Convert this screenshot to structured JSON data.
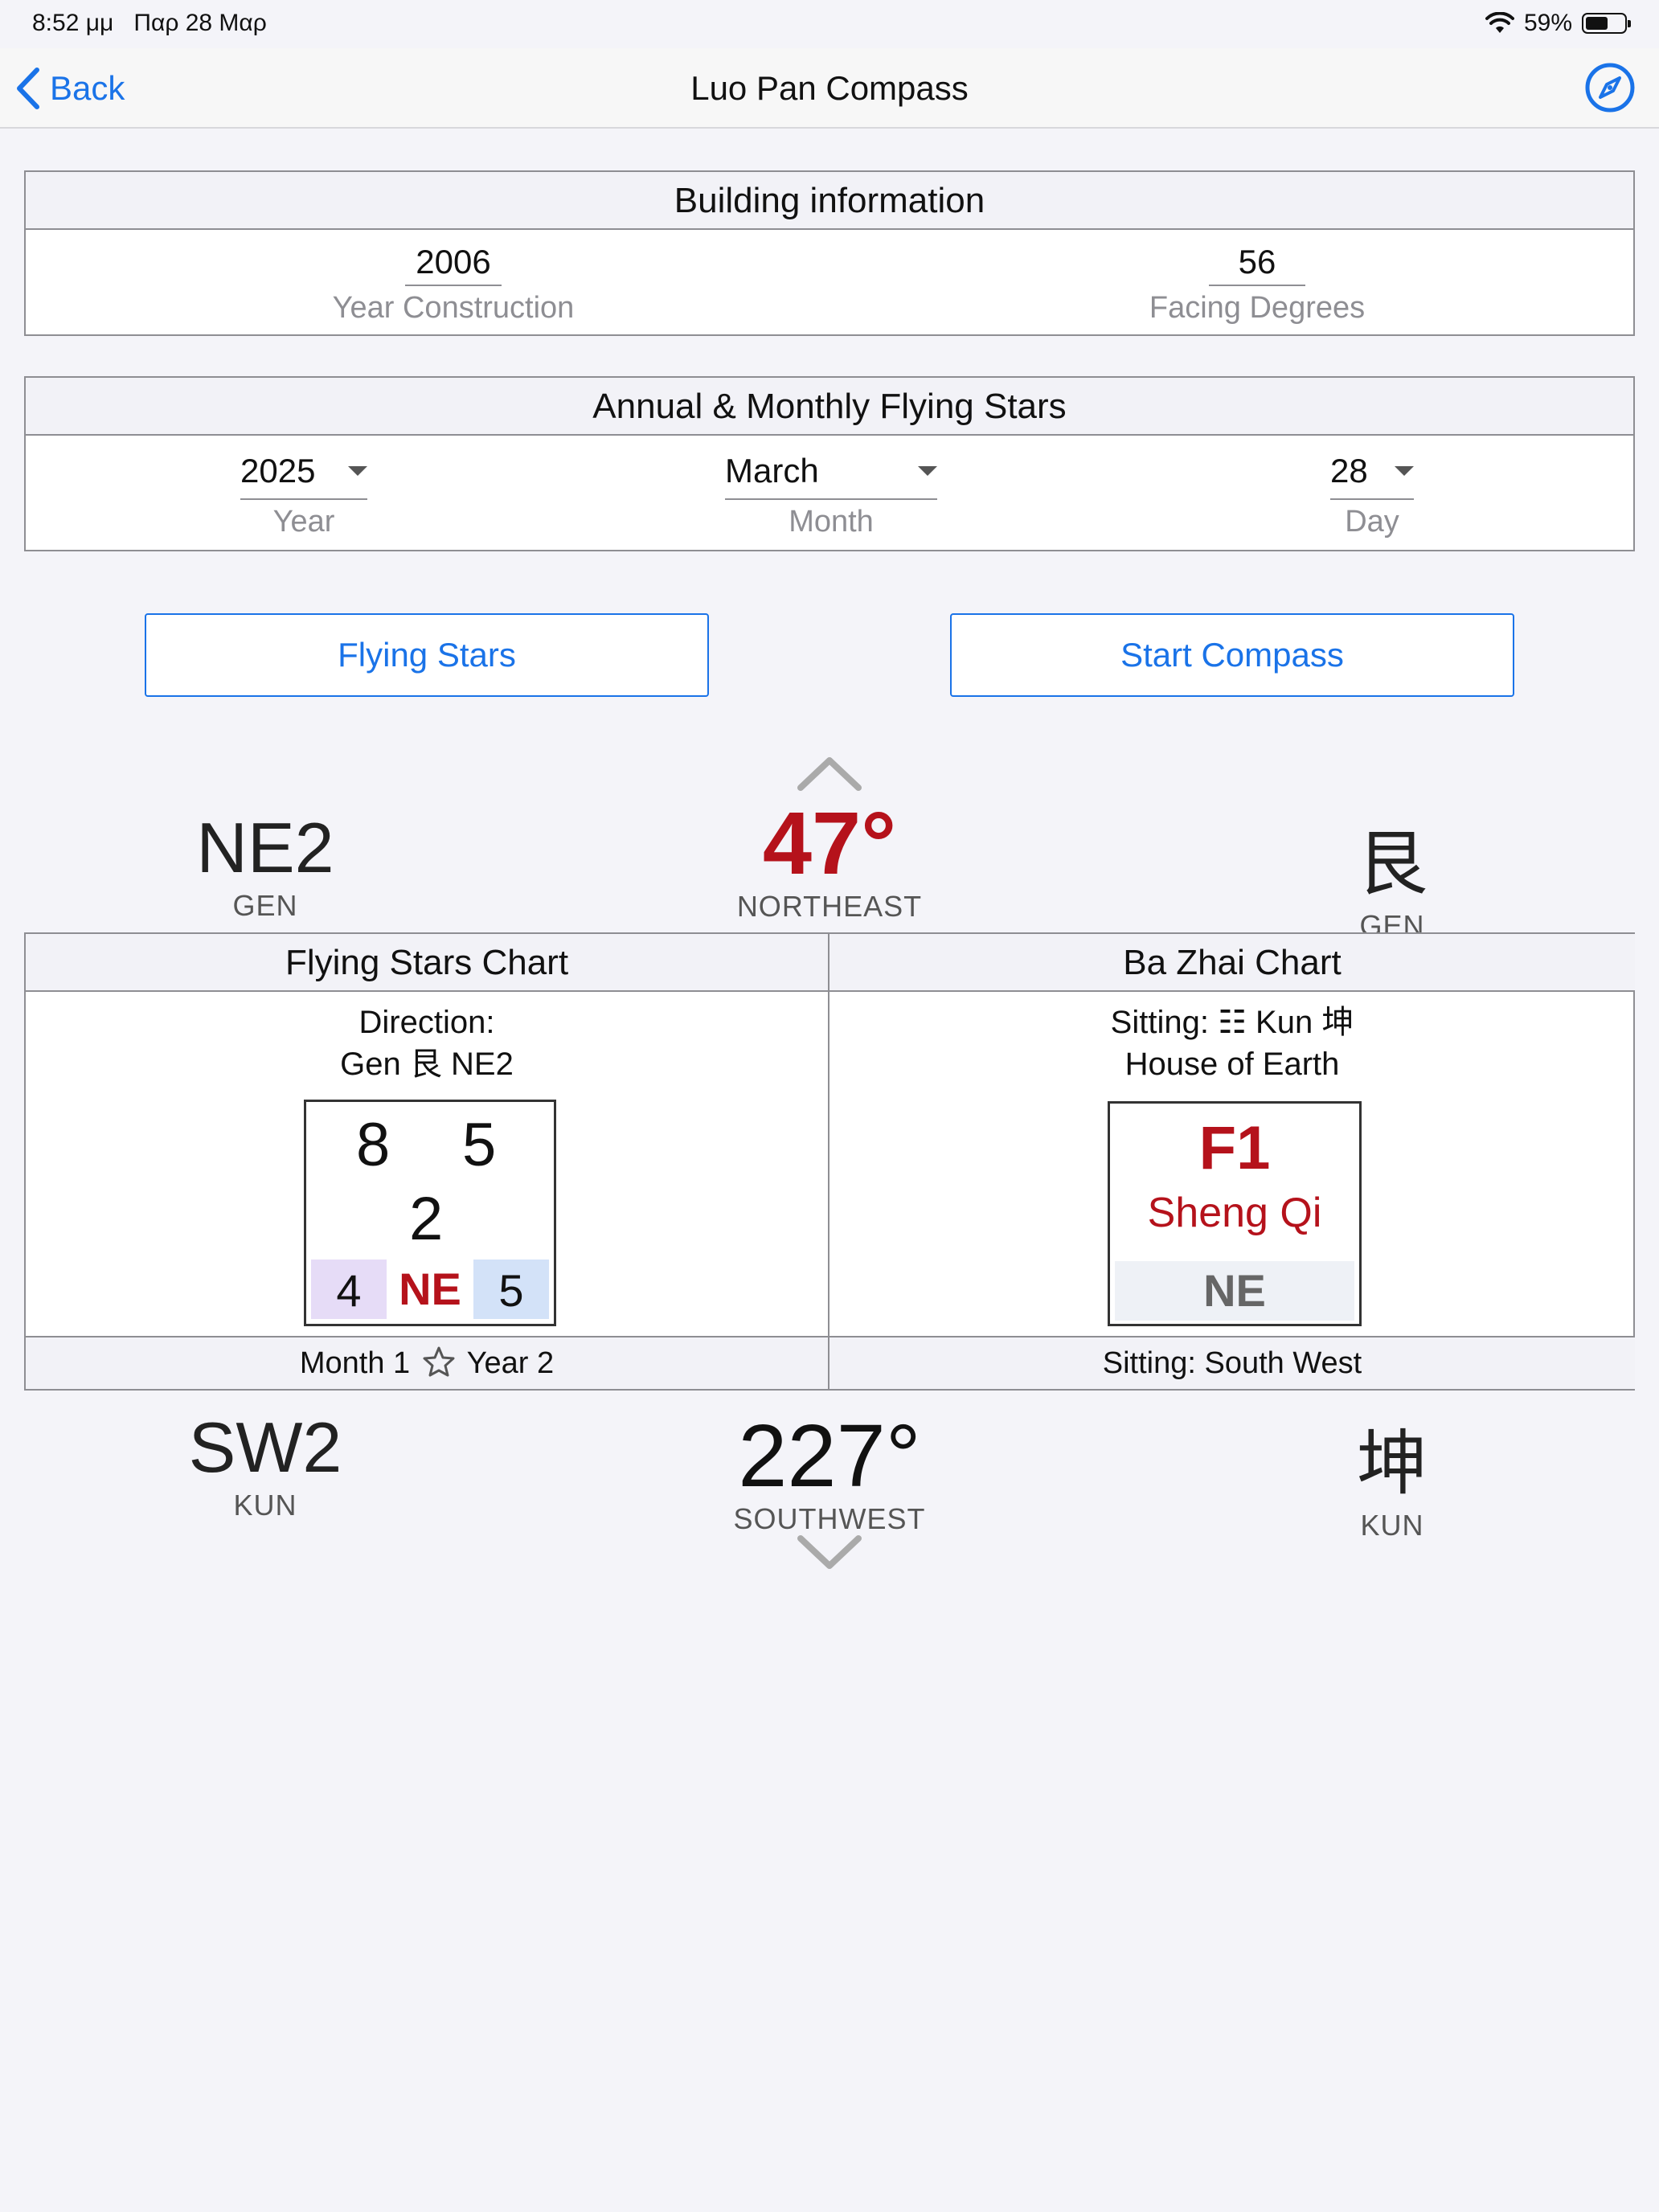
{
  "status_bar": {
    "time": "8:52 μμ",
    "date": "Παρ 28 Μαρ",
    "battery": "59%",
    "battery_level": 0.59
  },
  "nav": {
    "back_label": "Back",
    "title": "Luo Pan Compass"
  },
  "building": {
    "header": "Building information",
    "year_value": "2006",
    "year_label": "Year Construction",
    "facing_value": "56",
    "facing_label": "Facing Degrees"
  },
  "stars_panel": {
    "header": "Annual & Monthly Flying Stars",
    "year_value": "2025",
    "year_label": "Year",
    "month_value": "March",
    "month_label": "Month",
    "day_value": "28",
    "day_label": "Day"
  },
  "buttons": {
    "flying_stars": "Flying Stars",
    "start_compass": "Start Compass"
  },
  "facing": {
    "mountain": "NE2",
    "mountain_name": "GEN",
    "degrees": "47°",
    "direction": "NORTHEAST",
    "trigram_char": "艮",
    "trigram_name": "GEN"
  },
  "sitting": {
    "mountain": "SW2",
    "mountain_name": "KUN",
    "degrees": "227°",
    "direction": "SOUTHWEST",
    "trigram_char": "坤",
    "trigram_name": "KUN"
  },
  "flying_chart": {
    "header": "Flying Stars Chart",
    "desc_line1": "Direction:",
    "desc_line2": "Gen 艮 NE2",
    "mountain_star": "8",
    "water_star": "5",
    "base_star": "2",
    "month_star": "4",
    "sector": "NE",
    "year_star": "5",
    "footer_month": "Month 1",
    "footer_year": "Year 2"
  },
  "bazhai_chart": {
    "header": "Ba Zhai Chart",
    "desc_line1": "Sitting: ☷ Kun 坤",
    "desc_line2": "House of Earth",
    "code": "F1",
    "name": "Sheng Qi",
    "sector": "NE",
    "footer": "Sitting: South West"
  },
  "colors": {
    "accent": "#1a73e8",
    "red": "#b5121b",
    "purple_cell": "#e6dcf7",
    "blue_cell": "#d3e2f8"
  }
}
